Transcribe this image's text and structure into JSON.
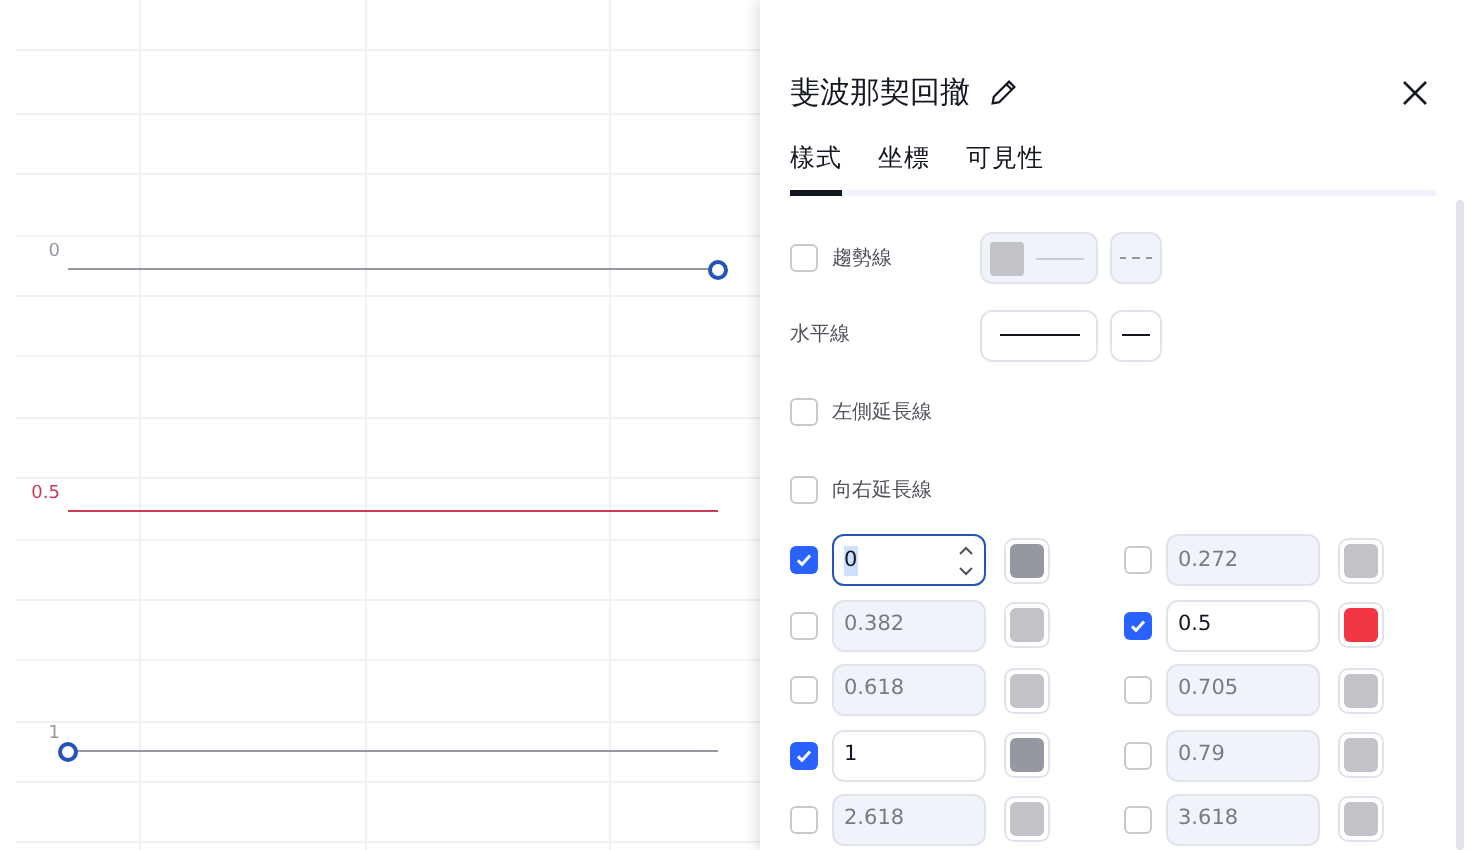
{
  "chart": {
    "levels": [
      {
        "label": "0",
        "color": "#9598a1",
        "start_handle": false,
        "end_handle": true
      },
      {
        "label": "0.5",
        "color": "#cc3a57",
        "start_handle": false,
        "end_handle": false
      },
      {
        "label": "1",
        "color": "#9598a1",
        "start_handle": true,
        "end_handle": false
      }
    ]
  },
  "panel": {
    "title": "斐波那契回撤",
    "tabs": [
      {
        "label": "樣式",
        "selected": true
      },
      {
        "label": "坐標",
        "selected": false
      },
      {
        "label": "可見性",
        "selected": false
      }
    ],
    "options": [
      {
        "kind": "trend",
        "label": "趨勢線",
        "checked": false
      },
      {
        "kind": "horizontal",
        "label": "水平線"
      },
      {
        "kind": "check",
        "label": "左側延長線",
        "checked": false
      },
      {
        "kind": "check",
        "label": "向右延長線",
        "checked": false
      }
    ],
    "levels": [
      {
        "value": "0",
        "checked": true,
        "focused": true,
        "color": "#9598a1"
      },
      {
        "value": "0.272",
        "checked": false,
        "focused": false,
        "color": "#c1c3c9"
      },
      {
        "value": "0.382",
        "checked": false,
        "focused": false,
        "color": "#c1c3c9"
      },
      {
        "value": "0.5",
        "checked": true,
        "focused": false,
        "color": "#f23645"
      },
      {
        "value": "0.618",
        "checked": false,
        "focused": false,
        "color": "#c1c3c9"
      },
      {
        "value": "0.705",
        "checked": false,
        "focused": false,
        "color": "#c1c3c9"
      },
      {
        "value": "1",
        "checked": true,
        "focused": false,
        "color": "#9598a1"
      },
      {
        "value": "0.79",
        "checked": false,
        "focused": false,
        "color": "#c1c3c9"
      },
      {
        "value": "2.618",
        "checked": false,
        "focused": false,
        "color": "#c1c3c9"
      },
      {
        "value": "3.618",
        "checked": false,
        "focused": false,
        "color": "#c1c3c9"
      }
    ]
  }
}
